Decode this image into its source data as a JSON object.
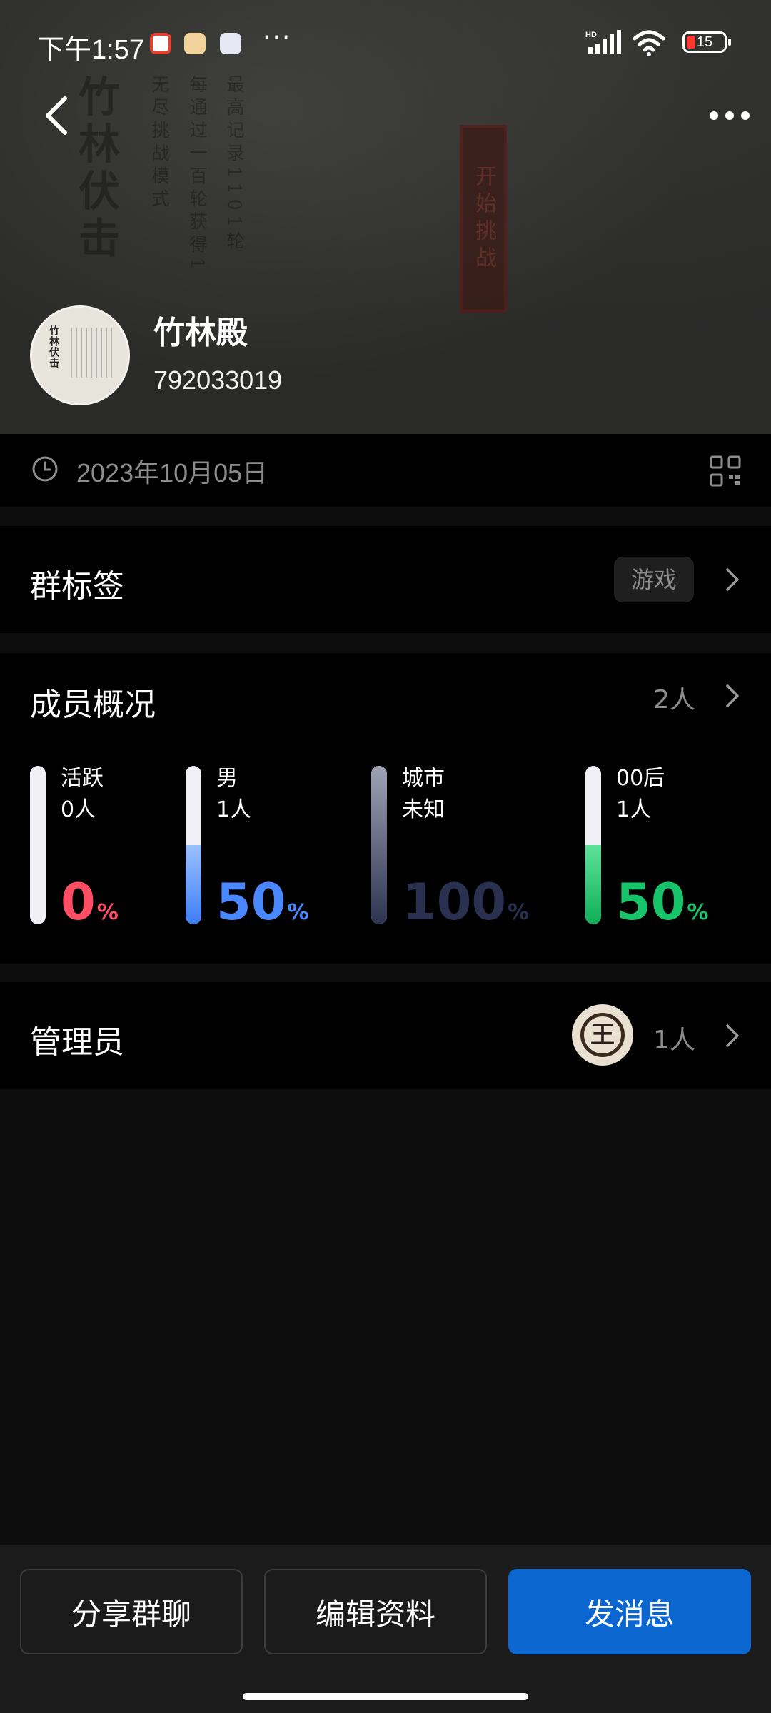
{
  "status_bar": {
    "time": "下午1:57",
    "more_dots": "···",
    "battery_level": "15"
  },
  "cover": {
    "title_big": "竹林伏击",
    "subtitle": "无尽挑战模式",
    "line1": "每通过一百轮获得1",
    "line2": "最高记录1101轮",
    "stamp": "开始挑战"
  },
  "group": {
    "name": "竹林殿",
    "id": "792033019",
    "avatar_text": "竹林伏击"
  },
  "date_row": {
    "date": "2023年10月05日"
  },
  "tags": {
    "title": "群标签",
    "chip": "游戏"
  },
  "members": {
    "title": "成员概况",
    "count": "2人",
    "stats": [
      {
        "label": "活跃",
        "sub": "0人",
        "percent": "0",
        "unit": "%",
        "fill": 0,
        "color": "#ff4d64",
        "bar_from": "#ff4d64",
        "bar_to": "#ff4d64"
      },
      {
        "label": "男",
        "sub": "1人",
        "percent": "50",
        "unit": "%",
        "fill": 0.5,
        "color": "#4a88ff",
        "bar_from": "#9cc0ff",
        "bar_to": "#3f7df5"
      },
      {
        "label": "城市",
        "sub": "未知",
        "percent": "100",
        "unit": "%",
        "fill": 1,
        "color": "#2a3150",
        "bar_from": "#a0a3b5",
        "bar_to": "#2d3350"
      },
      {
        "label": "00后",
        "sub": "1人",
        "percent": "50",
        "unit": "%",
        "fill": 0.5,
        "color": "#18c46a",
        "bar_from": "#5ee39a",
        "bar_to": "#0fae57"
      }
    ]
  },
  "admins": {
    "title": "管理员",
    "count": "1人",
    "avatar_glyph": "王"
  },
  "bottom_bar": {
    "share": "分享群聊",
    "edit": "编辑资料",
    "send": "发消息"
  },
  "colors": {
    "primary": "#0b66cf",
    "background": "#0d0d0d",
    "card": "#000000"
  }
}
